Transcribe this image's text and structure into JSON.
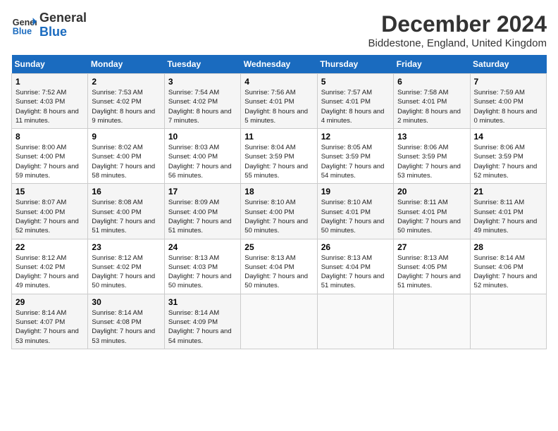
{
  "logo": {
    "line1": "General",
    "line2": "Blue"
  },
  "title": "December 2024",
  "subtitle": "Biddestone, England, United Kingdom",
  "days_header": [
    "Sunday",
    "Monday",
    "Tuesday",
    "Wednesday",
    "Thursday",
    "Friday",
    "Saturday"
  ],
  "weeks": [
    [
      {
        "num": "1",
        "sunrise": "7:52 AM",
        "sunset": "4:03 PM",
        "daylight": "8 hours and 11 minutes."
      },
      {
        "num": "2",
        "sunrise": "7:53 AM",
        "sunset": "4:02 PM",
        "daylight": "8 hours and 9 minutes."
      },
      {
        "num": "3",
        "sunrise": "7:54 AM",
        "sunset": "4:02 PM",
        "daylight": "8 hours and 7 minutes."
      },
      {
        "num": "4",
        "sunrise": "7:56 AM",
        "sunset": "4:01 PM",
        "daylight": "8 hours and 5 minutes."
      },
      {
        "num": "5",
        "sunrise": "7:57 AM",
        "sunset": "4:01 PM",
        "daylight": "8 hours and 4 minutes."
      },
      {
        "num": "6",
        "sunrise": "7:58 AM",
        "sunset": "4:01 PM",
        "daylight": "8 hours and 2 minutes."
      },
      {
        "num": "7",
        "sunrise": "7:59 AM",
        "sunset": "4:00 PM",
        "daylight": "8 hours and 0 minutes."
      }
    ],
    [
      {
        "num": "8",
        "sunrise": "8:00 AM",
        "sunset": "4:00 PM",
        "daylight": "7 hours and 59 minutes."
      },
      {
        "num": "9",
        "sunrise": "8:02 AM",
        "sunset": "4:00 PM",
        "daylight": "7 hours and 58 minutes."
      },
      {
        "num": "10",
        "sunrise": "8:03 AM",
        "sunset": "4:00 PM",
        "daylight": "7 hours and 56 minutes."
      },
      {
        "num": "11",
        "sunrise": "8:04 AM",
        "sunset": "3:59 PM",
        "daylight": "7 hours and 55 minutes."
      },
      {
        "num": "12",
        "sunrise": "8:05 AM",
        "sunset": "3:59 PM",
        "daylight": "7 hours and 54 minutes."
      },
      {
        "num": "13",
        "sunrise": "8:06 AM",
        "sunset": "3:59 PM",
        "daylight": "7 hours and 53 minutes."
      },
      {
        "num": "14",
        "sunrise": "8:06 AM",
        "sunset": "3:59 PM",
        "daylight": "7 hours and 52 minutes."
      }
    ],
    [
      {
        "num": "15",
        "sunrise": "8:07 AM",
        "sunset": "4:00 PM",
        "daylight": "7 hours and 52 minutes."
      },
      {
        "num": "16",
        "sunrise": "8:08 AM",
        "sunset": "4:00 PM",
        "daylight": "7 hours and 51 minutes."
      },
      {
        "num": "17",
        "sunrise": "8:09 AM",
        "sunset": "4:00 PM",
        "daylight": "7 hours and 51 minutes."
      },
      {
        "num": "18",
        "sunrise": "8:10 AM",
        "sunset": "4:00 PM",
        "daylight": "7 hours and 50 minutes."
      },
      {
        "num": "19",
        "sunrise": "8:10 AM",
        "sunset": "4:01 PM",
        "daylight": "7 hours and 50 minutes."
      },
      {
        "num": "20",
        "sunrise": "8:11 AM",
        "sunset": "4:01 PM",
        "daylight": "7 hours and 50 minutes."
      },
      {
        "num": "21",
        "sunrise": "8:11 AM",
        "sunset": "4:01 PM",
        "daylight": "7 hours and 49 minutes."
      }
    ],
    [
      {
        "num": "22",
        "sunrise": "8:12 AM",
        "sunset": "4:02 PM",
        "daylight": "7 hours and 49 minutes."
      },
      {
        "num": "23",
        "sunrise": "8:12 AM",
        "sunset": "4:02 PM",
        "daylight": "7 hours and 50 minutes."
      },
      {
        "num": "24",
        "sunrise": "8:13 AM",
        "sunset": "4:03 PM",
        "daylight": "7 hours and 50 minutes."
      },
      {
        "num": "25",
        "sunrise": "8:13 AM",
        "sunset": "4:04 PM",
        "daylight": "7 hours and 50 minutes."
      },
      {
        "num": "26",
        "sunrise": "8:13 AM",
        "sunset": "4:04 PM",
        "daylight": "7 hours and 51 minutes."
      },
      {
        "num": "27",
        "sunrise": "8:13 AM",
        "sunset": "4:05 PM",
        "daylight": "7 hours and 51 minutes."
      },
      {
        "num": "28",
        "sunrise": "8:14 AM",
        "sunset": "4:06 PM",
        "daylight": "7 hours and 52 minutes."
      }
    ],
    [
      {
        "num": "29",
        "sunrise": "8:14 AM",
        "sunset": "4:07 PM",
        "daylight": "7 hours and 53 minutes."
      },
      {
        "num": "30",
        "sunrise": "8:14 AM",
        "sunset": "4:08 PM",
        "daylight": "7 hours and 53 minutes."
      },
      {
        "num": "31",
        "sunrise": "8:14 AM",
        "sunset": "4:09 PM",
        "daylight": "7 hours and 54 minutes."
      },
      null,
      null,
      null,
      null
    ]
  ]
}
